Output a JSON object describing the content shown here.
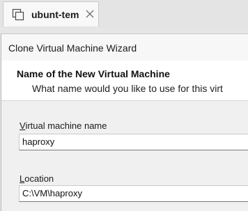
{
  "tab": {
    "title": "ubunt-tem",
    "icon": "vm-copies-icon",
    "close_icon": "close-icon"
  },
  "wizard": {
    "window_title": "Clone Virtual Machine Wizard",
    "page_title": "Name of the New Virtual Machine",
    "page_subtitle": "What name would you like to use for this virt",
    "vm_name_label_mnemonic": "V",
    "vm_name_label_rest": "irtual machine name",
    "vm_name_value": "haproxy",
    "location_label_mnemonic": "L",
    "location_label_rest": "ocation",
    "location_value": "C:\\VM\\haproxy"
  }
}
